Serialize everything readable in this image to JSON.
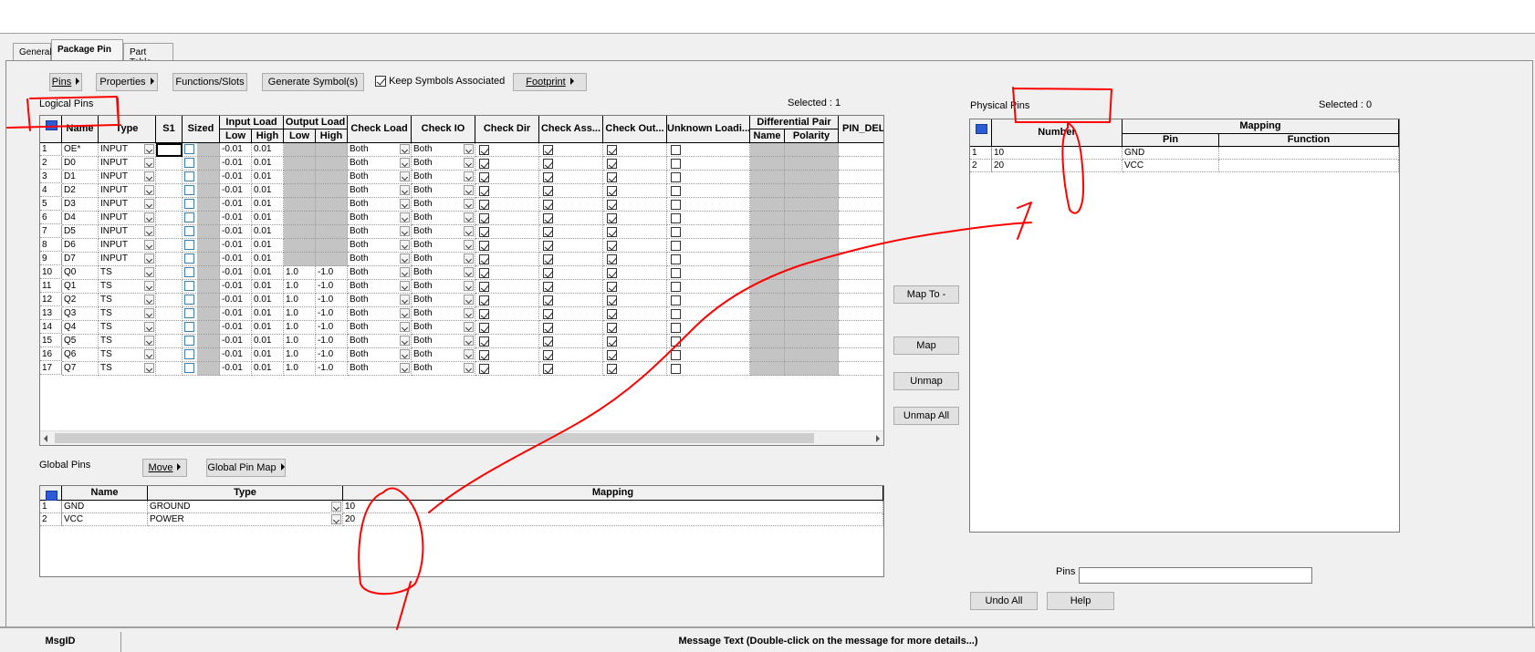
{
  "tabs": [
    "General",
    "Package Pin",
    "Part Table"
  ],
  "toolbar": {
    "pins": "Pins",
    "properties": "Properties",
    "functions_slots": "Functions/Slots",
    "generate_symbols": "Generate Symbol(s)",
    "keep_symbols": "Keep Symbols Associated",
    "keep_symbols_checked": true,
    "footprint": "Footprint"
  },
  "logical": {
    "title": "Logical Pins",
    "selected_label": "Selected :",
    "selected_count": "1",
    "headers": {
      "name": "Name",
      "type": "Type",
      "s1": "S1",
      "sized": "Sized",
      "input_load": "Input Load",
      "output_load": "Output Load",
      "low": "Low",
      "high": "High",
      "check_load": "Check Load",
      "check_io": "Check IO",
      "check_dir": "Check Dir",
      "check_ass": "Check Ass...",
      "check_out": "Check Out...",
      "unknown": "Unknown Loadi...",
      "diff_pair": "Differential Pair",
      "dp_name": "Name",
      "dp_polarity": "Polarity",
      "pin_del": "PIN_DEL/"
    },
    "rows": [
      {
        "n": "1",
        "name": "OE*",
        "type": "INPUT",
        "in_low": "-0.01",
        "in_high": "0.01",
        "out_low": "",
        "out_high": "",
        "check_load": "Both",
        "check_io": "Both"
      },
      {
        "n": "2",
        "name": "D0",
        "type": "INPUT",
        "in_low": "-0.01",
        "in_high": "0.01",
        "out_low": "",
        "out_high": "",
        "check_load": "Both",
        "check_io": "Both"
      },
      {
        "n": "3",
        "name": "D1",
        "type": "INPUT",
        "in_low": "-0.01",
        "in_high": "0.01",
        "out_low": "",
        "out_high": "",
        "check_load": "Both",
        "check_io": "Both"
      },
      {
        "n": "4",
        "name": "D2",
        "type": "INPUT",
        "in_low": "-0.01",
        "in_high": "0.01",
        "out_low": "",
        "out_high": "",
        "check_load": "Both",
        "check_io": "Both"
      },
      {
        "n": "5",
        "name": "D3",
        "type": "INPUT",
        "in_low": "-0.01",
        "in_high": "0.01",
        "out_low": "",
        "out_high": "",
        "check_load": "Both",
        "check_io": "Both"
      },
      {
        "n": "6",
        "name": "D4",
        "type": "INPUT",
        "in_low": "-0.01",
        "in_high": "0.01",
        "out_low": "",
        "out_high": "",
        "check_load": "Both",
        "check_io": "Both"
      },
      {
        "n": "7",
        "name": "D5",
        "type": "INPUT",
        "in_low": "-0.01",
        "in_high": "0.01",
        "out_low": "",
        "out_high": "",
        "check_load": "Both",
        "check_io": "Both"
      },
      {
        "n": "8",
        "name": "D6",
        "type": "INPUT",
        "in_low": "-0.01",
        "in_high": "0.01",
        "out_low": "",
        "out_high": "",
        "check_load": "Both",
        "check_io": "Both"
      },
      {
        "n": "9",
        "name": "D7",
        "type": "INPUT",
        "in_low": "-0.01",
        "in_high": "0.01",
        "out_low": "",
        "out_high": "",
        "check_load": "Both",
        "check_io": "Both"
      },
      {
        "n": "10",
        "name": "Q0",
        "type": "TS",
        "in_low": "-0.01",
        "in_high": "0.01",
        "out_low": "1.0",
        "out_high": "-1.0",
        "check_load": "Both",
        "check_io": "Both"
      },
      {
        "n": "11",
        "name": "Q1",
        "type": "TS",
        "in_low": "-0.01",
        "in_high": "0.01",
        "out_low": "1.0",
        "out_high": "-1.0",
        "check_load": "Both",
        "check_io": "Both"
      },
      {
        "n": "12",
        "name": "Q2",
        "type": "TS",
        "in_low": "-0.01",
        "in_high": "0.01",
        "out_low": "1.0",
        "out_high": "-1.0",
        "check_load": "Both",
        "check_io": "Both"
      },
      {
        "n": "13",
        "name": "Q3",
        "type": "TS",
        "in_low": "-0.01",
        "in_high": "0.01",
        "out_low": "1.0",
        "out_high": "-1.0",
        "check_load": "Both",
        "check_io": "Both"
      },
      {
        "n": "14",
        "name": "Q4",
        "type": "TS",
        "in_low": "-0.01",
        "in_high": "0.01",
        "out_low": "1.0",
        "out_high": "-1.0",
        "check_load": "Both",
        "check_io": "Both"
      },
      {
        "n": "15",
        "name": "Q5",
        "type": "TS",
        "in_low": "-0.01",
        "in_high": "0.01",
        "out_low": "1.0",
        "out_high": "-1.0",
        "check_load": "Both",
        "check_io": "Both"
      },
      {
        "n": "16",
        "name": "Q6",
        "type": "TS",
        "in_low": "-0.01",
        "in_high": "0.01",
        "out_low": "1.0",
        "out_high": "-1.0",
        "check_load": "Both",
        "check_io": "Both"
      },
      {
        "n": "17",
        "name": "Q7",
        "type": "TS",
        "in_low": "-0.01",
        "in_high": "0.01",
        "out_low": "1.0",
        "out_high": "-1.0",
        "check_load": "Both",
        "check_io": "Both"
      }
    ]
  },
  "global": {
    "title": "Global Pins",
    "move": "Move",
    "global_pin_map": "Global Pin Map",
    "headers": {
      "name": "Name",
      "type": "Type",
      "mapping": "Mapping"
    },
    "rows": [
      {
        "n": "1",
        "name": "GND",
        "type": "GROUND",
        "mapping": "10"
      },
      {
        "n": "2",
        "name": "VCC",
        "type": "POWER",
        "mapping": "20"
      }
    ]
  },
  "physical": {
    "title": "Physical Pins",
    "selected_label": "Selected :",
    "selected_count": "0",
    "headers": {
      "number": "Number",
      "mapping": "Mapping",
      "pin": "Pin",
      "function": "Function"
    },
    "rows": [
      {
        "n": "1",
        "number": "10",
        "pin": "GND",
        "function": ""
      },
      {
        "n": "2",
        "number": "20",
        "pin": "VCC",
        "function": ""
      }
    ],
    "pins_label": "Pins",
    "pins_value": ""
  },
  "actions": {
    "map_to": "Map To -",
    "map": "Map",
    "unmap": "Unmap",
    "unmap_all": "Unmap All",
    "undo_all": "Undo All",
    "help": "Help"
  },
  "messages": {
    "msg_id": "MsgID",
    "msg_text": "Message Text (Double-click on the message for more details...)"
  },
  "annotation_color": "#ff0000"
}
